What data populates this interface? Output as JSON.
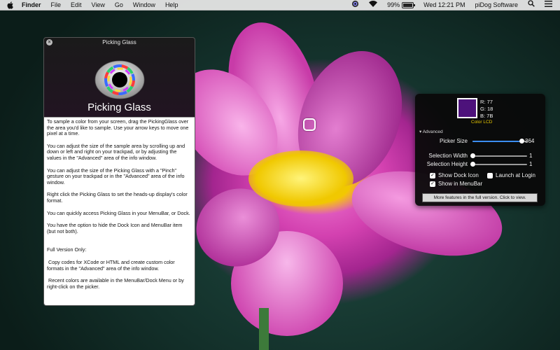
{
  "menubar": {
    "app_name": "Finder",
    "menus": [
      "File",
      "Edit",
      "View",
      "Go",
      "Window",
      "Help"
    ],
    "battery_percent": "99%",
    "battery_level": 0.99,
    "clock": "Wed 12:21 PM",
    "user": "piDog Software"
  },
  "info_window": {
    "title": "Picking Glass",
    "app_title": "Picking Glass",
    "paragraphs": [
      "To sample a color from your screen, drag the PickingGlass over the area you'd like to sample. Use your arrow keys to move one pixel at a time.",
      "You can adjust the size of the sample area by scrolling up and down or left and right on your trackpad, or by adjusting the values in the \"Advanced\" area of the info window.",
      "You can adjust the size of the Picking Glass with a \"Pinch\" gesture on your trackpad or in the \"Advanced\" area of the info window.",
      "Right click the Picking Glass to set the heads-up display's color format.",
      "You can quickly access Picking Glass in your MenuBar, or Dock.",
      "You have the option to hide the Dock Icon and MenuBar item (but not both).",
      "Full Version Only:",
      " Copy codes for XCode or HTML and create custom color formats in the \"Advanced\" area of the info window.",
      " Recent colors are available in the MenuBar/Dock Menu or by right-click on the picker."
    ]
  },
  "hud": {
    "swatch_color": "#4D127B",
    "r": "R: 77",
    "g": "G: 18",
    "b": "B: 7B",
    "color_format": "Color LCD",
    "advanced_label": "Advanced",
    "picker_size": {
      "label": "Picker Size",
      "value": "364",
      "fraction": 0.9
    },
    "selection_width": {
      "label": "Selection Width",
      "value": "1",
      "fraction": 0.0
    },
    "selection_height": {
      "label": "Selection Height",
      "value": "1",
      "fraction": 0.0
    },
    "show_dock_icon": {
      "label": "Show Dock Icon",
      "checked": true
    },
    "launch_at_login": {
      "label": "Launch at Login",
      "checked": false
    },
    "show_in_menubar": {
      "label": "Show in MenuBar",
      "checked": true
    },
    "upsell": "More features in the full version. Click to view."
  }
}
